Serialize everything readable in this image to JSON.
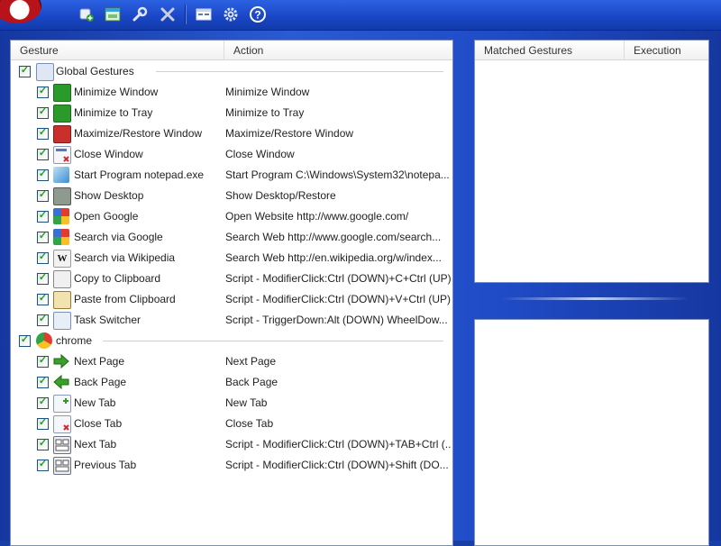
{
  "toolbar": {
    "icons": [
      "add-gesture-icon",
      "new-window-icon",
      "wrench-icon",
      "delete-icon",
      "window-icon",
      "gear-icon",
      "help-icon"
    ]
  },
  "left_table": {
    "columns": [
      "Gesture",
      "Action"
    ],
    "groups": [
      {
        "name": "Global Gestures",
        "icon": "global-gestures-icon",
        "items": [
          {
            "name": "Minimize Window",
            "action": "Minimize Window",
            "icon": "minimize-window-icon"
          },
          {
            "name": "Minimize to Tray",
            "action": "Minimize to Tray",
            "icon": "minimize-tray-icon"
          },
          {
            "name": "Maximize/Restore Window",
            "action": "Maximize/Restore Window",
            "icon": "maximize-window-icon"
          },
          {
            "name": "Close Window",
            "action": "Close Window",
            "icon": "close-window-icon"
          },
          {
            "name": "Start Program notepad.exe",
            "action": "Start Program C:\\Windows\\System32\\notepa...",
            "icon": "notepad-icon"
          },
          {
            "name": "Show Desktop",
            "action": "Show Desktop/Restore",
            "icon": "desktop-icon"
          },
          {
            "name": "Open Google",
            "action": "Open Website http://www.google.com/",
            "icon": "google-icon"
          },
          {
            "name": "Search via Google",
            "action": "Search Web http://www.google.com/search...",
            "icon": "google-icon"
          },
          {
            "name": "Search via Wikipedia",
            "action": "Search Web http://en.wikipedia.org/w/index...",
            "icon": "wikipedia-icon"
          },
          {
            "name": "Copy to Clipboard",
            "action": "Script - ModifierClick:Ctrl (DOWN)+C+Ctrl (UP)",
            "icon": "copy-icon"
          },
          {
            "name": "Paste from Clipboard",
            "action": "Script - ModifierClick:Ctrl (DOWN)+V+Ctrl (UP)",
            "icon": "paste-icon"
          },
          {
            "name": "Task Switcher",
            "action": "Script - TriggerDown:Alt (DOWN) WheelDow...",
            "icon": "task-switcher-icon"
          }
        ]
      },
      {
        "name": "chrome",
        "icon": "chrome-icon",
        "items": [
          {
            "name": "Next Page",
            "action": "Next Page",
            "icon": "arrow-right-icon"
          },
          {
            "name": "Back Page",
            "action": "Back Page",
            "icon": "arrow-left-icon"
          },
          {
            "name": "New Tab",
            "action": "New Tab",
            "icon": "new-tab-icon"
          },
          {
            "name": "Close Tab",
            "action": "Close Tab",
            "icon": "close-tab-icon"
          },
          {
            "name": "Next Tab",
            "action": "Script - ModifierClick:Ctrl (DOWN)+TAB+Ctrl (...",
            "icon": "keyboard-icon"
          },
          {
            "name": "Previous Tab",
            "action": "Script - ModifierClick:Ctrl (DOWN)+Shift (DO...",
            "icon": "keyboard-icon"
          }
        ]
      }
    ]
  },
  "right_table": {
    "columns": [
      "Matched Gestures",
      "Execution"
    ]
  }
}
